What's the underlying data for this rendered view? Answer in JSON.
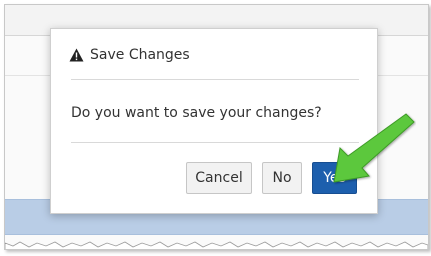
{
  "dialog": {
    "title": "Save Changes",
    "title_icon": "warning-triangle-icon",
    "message": "Do you want to save your changes?",
    "buttons": {
      "cancel_label": "Cancel",
      "no_label": "No",
      "yes_label": "Yes"
    }
  },
  "annotation": {
    "arrow_icon": "green-pointer-arrow-icon",
    "arrow_color": "#5cc83c"
  },
  "colors": {
    "primary_button": "#1d5fad",
    "secondary_button": "#f2f2f2",
    "background_band": "#b9cde6"
  }
}
